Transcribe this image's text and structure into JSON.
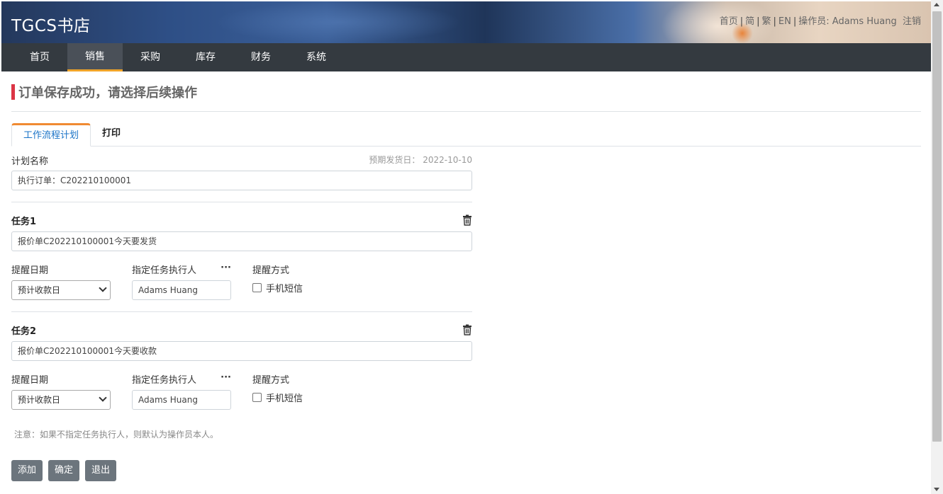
{
  "header": {
    "brand": "TGCS书店",
    "links": {
      "home": "首页",
      "simplified": "简",
      "traditional": "繁",
      "english": "EN",
      "operator_label": "操作员:",
      "operator_name": "Adams Huang",
      "logout": "注销"
    }
  },
  "nav": {
    "items": [
      {
        "label": "首页"
      },
      {
        "label": "销售"
      },
      {
        "label": "采购"
      },
      {
        "label": "库存"
      },
      {
        "label": "财务"
      },
      {
        "label": "系统"
      }
    ],
    "active": "销售"
  },
  "page_title": "订单保存成功，请选择后续操作",
  "tabs": [
    {
      "label": "工作流程计划"
    },
    {
      "label": "打印"
    }
  ],
  "plan": {
    "name_label": "计划名称",
    "ship_date_label": "预期发货日：",
    "ship_date": "2022-10-10",
    "name_value": "执行订单：C202210100001"
  },
  "tasks": [
    {
      "title": "任务1",
      "description": "报价单C202210100001今天要发货",
      "date_label": "提醒日期",
      "date_value": "预计收款日",
      "assignee_label": "指定任务执行人",
      "assignee_more": "···",
      "assignee_value": "Adams Huang",
      "method_label": "提醒方式",
      "method_option": "手机短信"
    },
    {
      "title": "任务2",
      "description": "报价单C202210100001今天要收款",
      "date_label": "提醒日期",
      "date_value": "预计收款日",
      "assignee_label": "指定任务执行人",
      "assignee_more": "···",
      "assignee_value": "Adams Huang",
      "method_label": "提醒方式",
      "method_option": "手机短信"
    }
  ],
  "note": "注意：如果不指定任务执行人，则默认为操作员本人。",
  "buttons": {
    "add": "添加",
    "confirm": "确定",
    "exit": "退出"
  },
  "colors": {
    "nav_bg": "#343a40",
    "nav_active_underline": "#f0a428",
    "title_bar": "#dc3545",
    "tab_active_top": "#f08a32",
    "tab_active_text": "#1a73c7",
    "button_bg": "#6c757d"
  },
  "icons": {
    "task_delete": "trash-icon",
    "select_arrow": "chevron-down-icon"
  }
}
